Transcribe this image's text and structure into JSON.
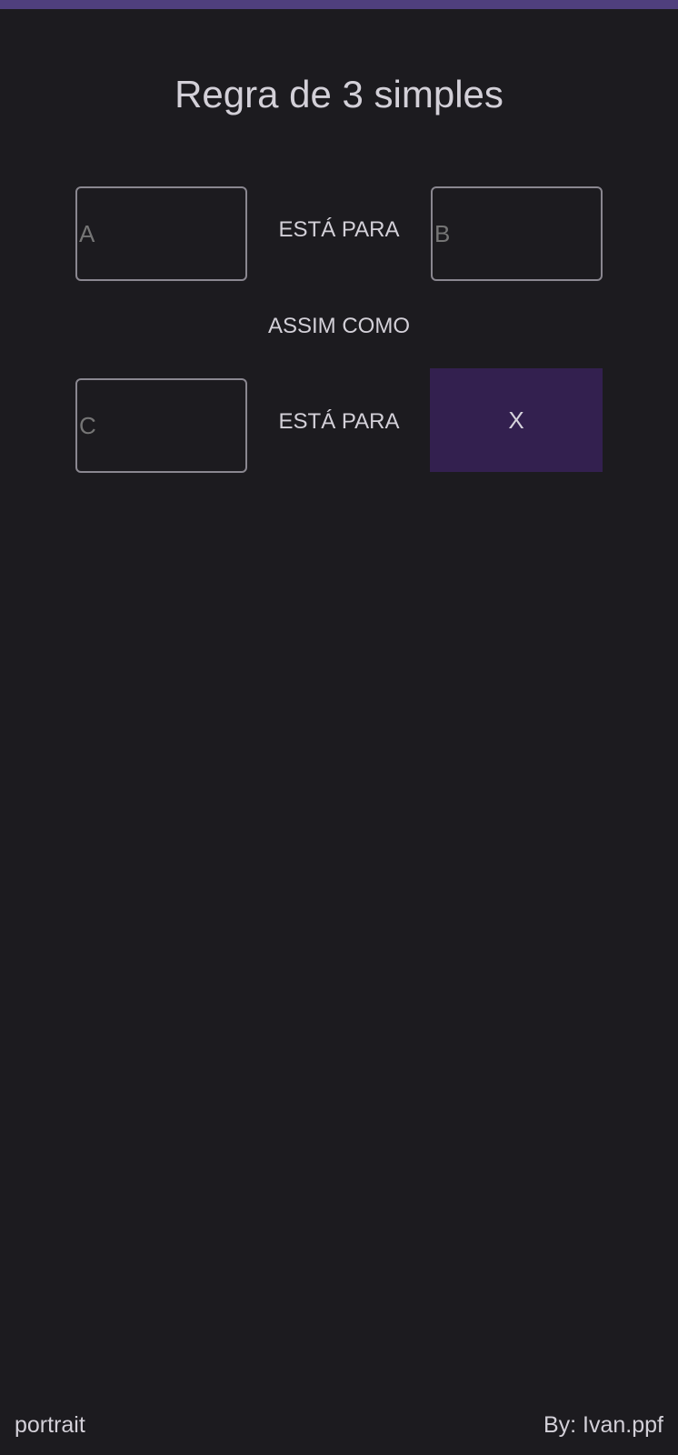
{
  "app": {
    "title": "Regra de 3 simples",
    "accent_color": "#4f3f7d"
  },
  "form": {
    "field_a": {
      "placeholder": "A",
      "value": ""
    },
    "field_b": {
      "placeholder": "B",
      "value": ""
    },
    "field_c": {
      "placeholder": "C",
      "value": ""
    },
    "result_x": {
      "label": "X",
      "color": "#33204f"
    },
    "connector_1": "ESTÁ PARA",
    "connector_2": "ASSIM COMO",
    "connector_3": "ESTÁ PARA"
  },
  "footer": {
    "orientation": "portrait",
    "credit": "By: Ivan.ppf"
  }
}
